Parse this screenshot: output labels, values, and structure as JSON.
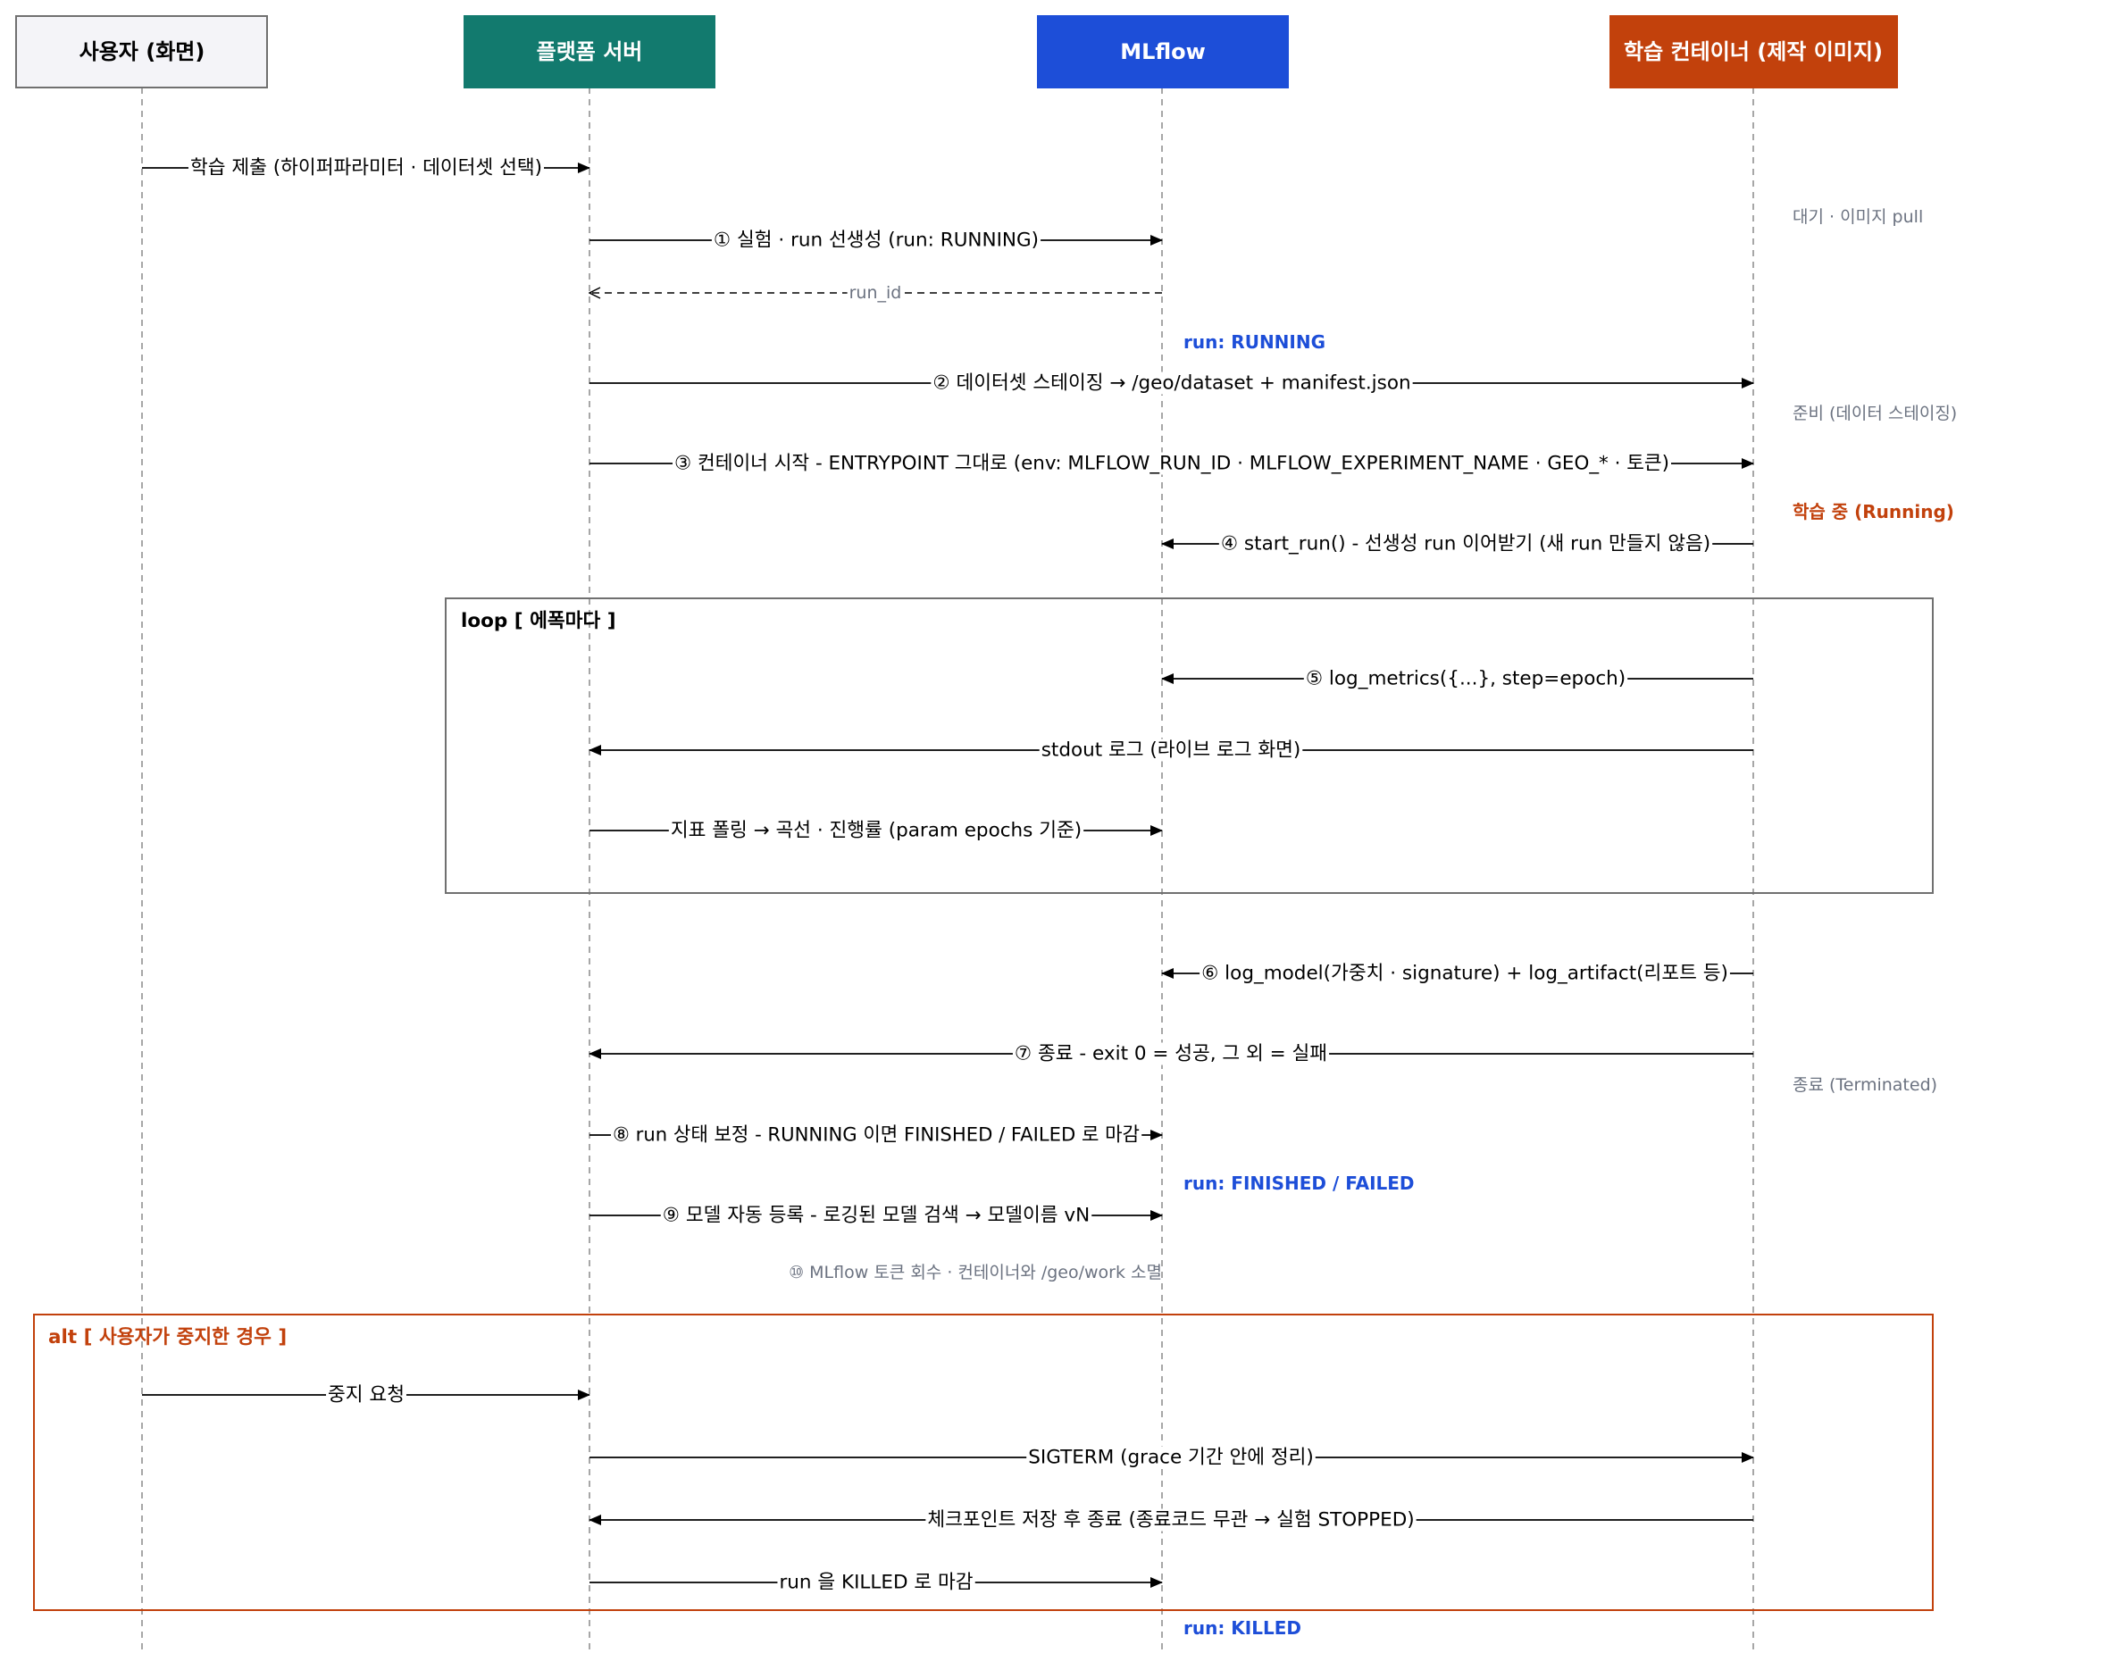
{
  "participants": [
    {
      "id": "user",
      "name": "사용자 (화면)",
      "fill": "#f4f4f8",
      "stroke": "#707070",
      "text_color": "#000000"
    },
    {
      "id": "platform",
      "name": "플랫폼 서버",
      "fill": "#127a6e",
      "stroke": "#127a6e",
      "text_color": "#ffffff"
    },
    {
      "id": "mlflow",
      "name": "MLflow",
      "fill": "#1d4ed8",
      "stroke": "#1d4ed8",
      "text_color": "#ffffff"
    },
    {
      "id": "container",
      "name": "학습 컨테이너 (제작 이미지)",
      "fill": "#c2410c",
      "stroke": "#c2410c",
      "text_color": "#ffffff"
    }
  ],
  "messages": [
    {
      "from": "user",
      "to": "platform",
      "label": "학습 제출 (하이퍼파라미터 · 데이터셋 선택)",
      "style": "solid"
    },
    {
      "from": "platform",
      "to": "mlflow",
      "label": "① 실험 · run 선생성 (run: RUNNING)",
      "style": "solid"
    },
    {
      "from": "mlflow",
      "to": "platform",
      "label": "run_id",
      "style": "dashed"
    },
    {
      "from": "platform",
      "to": "container",
      "label": "② 데이터셋 스테이징 → /geo/dataset + manifest.json",
      "style": "solid"
    },
    {
      "from": "platform",
      "to": "container",
      "label": "③ 컨테이너 시작 - ENTRYPOINT 그대로 (env: MLFLOW_RUN_ID · MLFLOW_EXPERIMENT_NAME · GEO_* · 토큰)",
      "style": "solid"
    },
    {
      "from": "container",
      "to": "mlflow",
      "label": "④ start_run() - 선생성 run 이어받기 (새 run 만들지 않음)",
      "style": "solid"
    },
    {
      "from": "container",
      "to": "mlflow",
      "label": "⑤ log_metrics({...}, step=epoch)",
      "style": "solid"
    },
    {
      "from": "container",
      "to": "platform",
      "label": "stdout 로그 (라이브 로그 화면)",
      "style": "solid"
    },
    {
      "from": "platform",
      "to": "mlflow",
      "label": "지표 폴링 → 곡선 · 진행률 (param epochs 기준)",
      "style": "solid"
    },
    {
      "from": "container",
      "to": "mlflow",
      "label": "⑥ log_model(가중치 · signature) + log_artifact(리포트 등)",
      "style": "solid"
    },
    {
      "from": "container",
      "to": "platform",
      "label": "⑦ 종료 - exit 0 = 성공, 그 외 = 실패",
      "style": "solid"
    },
    {
      "from": "platform",
      "to": "mlflow",
      "label": "⑧ run 상태 보정 - RUNNING 이면 FINISHED / FAILED 로 마감",
      "style": "solid"
    },
    {
      "from": "platform",
      "to": "mlflow",
      "label": "⑨ 모델 자동 등록 - 로깅된 모델 검색 → 모델이름 vN",
      "style": "solid"
    },
    {
      "from": "user",
      "to": "platform",
      "label": "중지 요청",
      "style": "solid"
    },
    {
      "from": "platform",
      "to": "container",
      "label": "SIGTERM (grace 기간 안에 정리)",
      "style": "solid"
    },
    {
      "from": "container",
      "to": "platform",
      "label": "체크포인트 저장 후 종료 (종료코드 무관 → 실험 STOPPED)",
      "style": "solid"
    },
    {
      "from": "platform",
      "to": "mlflow",
      "label": "run 을 KILLED 로 마감",
      "style": "solid"
    }
  ],
  "notes": [
    {
      "text": "대기 · 이미지 pull",
      "color": "#6b7280",
      "bold": false
    },
    {
      "text": "run: RUNNING",
      "color": "#1d4ed8",
      "bold": true
    },
    {
      "text": "준비 (데이터 스테이징)",
      "color": "#6b7280",
      "bold": false
    },
    {
      "text": "학습 중 (Running)",
      "color": "#c2410c",
      "bold": true
    },
    {
      "text": "종료 (Terminated)",
      "color": "#6b7280",
      "bold": false
    },
    {
      "text": "run: FINISHED / FAILED",
      "color": "#1d4ed8",
      "bold": true
    },
    {
      "text": "⑩ MLflow 토큰 회수 · 컨테이너와 /geo/work 소멸",
      "color": "#6b7280",
      "bold": false
    },
    {
      "text": "run: KILLED",
      "color": "#1d4ed8",
      "bold": true
    }
  ],
  "frames": [
    {
      "label": "loop [ 에폭마다 ]",
      "color": "#707070",
      "label_color": "#000000"
    },
    {
      "label": "alt [ 사용자가 중지한 경우 ]",
      "color": "#c2410c",
      "label_color": "#c2410c"
    }
  ]
}
